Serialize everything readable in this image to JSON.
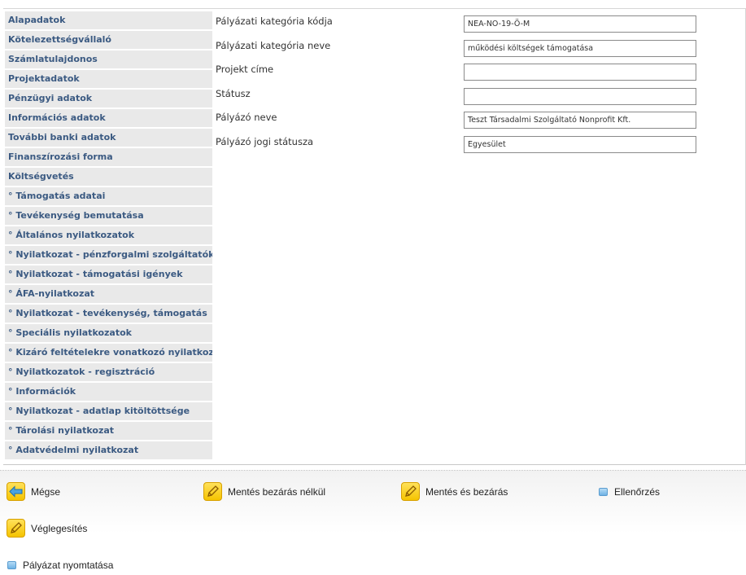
{
  "sidebar": {
    "items": [
      {
        "label": "Alapadatok"
      },
      {
        "label": "Kötelezettségvállaló"
      },
      {
        "label": "Számlatulajdonos"
      },
      {
        "label": "Projektadatok"
      },
      {
        "label": "Pénzügyi adatok"
      },
      {
        "label": "Információs adatok"
      },
      {
        "label": "További banki adatok"
      },
      {
        "label": "Finanszírozási forma"
      },
      {
        "label": "Költségvetés"
      },
      {
        "label": "° Támogatás adatai"
      },
      {
        "label": "° Tevékenység bemutatása"
      },
      {
        "label": "° Általános nyilatkozatok"
      },
      {
        "label": "° Nyilatkozat - pénzforgalmi szolgáltatók"
      },
      {
        "label": "° Nyilatkozat - támogatási igények"
      },
      {
        "label": "° ÁFA-nyilatkozat"
      },
      {
        "label": "° Nyilatkozat - tevékenység, támogatás"
      },
      {
        "label": "° Speciális nyilatkozatok"
      },
      {
        "label": "° Kizáró feltételekre vonatkozó nyilatkozat"
      },
      {
        "label": "° Nyilatkozatok - regisztráció"
      },
      {
        "label": "° Információk"
      },
      {
        "label": "° Nyilatkozat - adatlap kitöltöttsége"
      },
      {
        "label": "° Tárolási nyilatkozat"
      },
      {
        "label": "° Adatvédelmi nyilatkozat"
      }
    ]
  },
  "form": {
    "fields": [
      {
        "label": "Pályázati kategória kódja",
        "value": "NEA-NO-19-Ö-M"
      },
      {
        "label": "Pályázati kategória neve",
        "value": "működési költségek támogatása"
      },
      {
        "label": "Projekt címe",
        "value": ""
      },
      {
        "label": "Státusz",
        "value": ""
      },
      {
        "label": "Pályázó neve",
        "value": "Teszt Társadalmi Szolgáltató Nonprofit Kft."
      },
      {
        "label": "Pályázó jogi státusza",
        "value": "Egyesület"
      }
    ]
  },
  "actions": {
    "cancel": {
      "label": "Mégse",
      "icon": "back-arrow-icon"
    },
    "save_no_close": {
      "label": "Mentés bezárás nélkül",
      "icon": "pencil-icon"
    },
    "save_close": {
      "label": "Mentés és bezárás",
      "icon": "pencil-icon"
    },
    "check": {
      "label": "Ellenőrzés",
      "icon": "square-icon"
    },
    "finalize": {
      "label": "Véglegesítés",
      "icon": "pencil-icon"
    },
    "print": {
      "label": "Pályázat nyomtatása",
      "icon": "square-icon"
    }
  },
  "colors": {
    "sidebar_bg": "#e9e9e9",
    "sidebar_text": "#3b5a82",
    "icon_yellow": "#f5c400",
    "icon_blue": "#6fb2e4"
  }
}
